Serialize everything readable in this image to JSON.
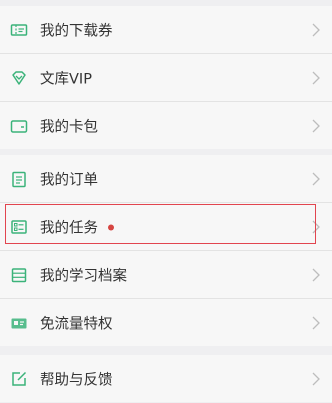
{
  "accent_color": "#3bb37a",
  "highlight_color": "#e2454f",
  "badge_color": "#d64541",
  "groups": [
    {
      "items": [
        {
          "label": "我的下载券",
          "icon": "ticket-icon"
        },
        {
          "label": "文库VIP",
          "icon": "diamond-icon"
        },
        {
          "label": "我的卡包",
          "icon": "wallet-icon"
        }
      ]
    },
    {
      "items": [
        {
          "label": "我的订单",
          "icon": "clipboard-icon"
        },
        {
          "label": "我的任务",
          "icon": "task-list-icon",
          "badge": true,
          "highlighted": true
        },
        {
          "label": "我的学习档案",
          "icon": "archive-icon"
        },
        {
          "label": "免流量特权",
          "icon": "data-card-icon"
        }
      ]
    },
    {
      "items": [
        {
          "label": "帮助与反馈",
          "icon": "edit-icon"
        }
      ]
    }
  ]
}
